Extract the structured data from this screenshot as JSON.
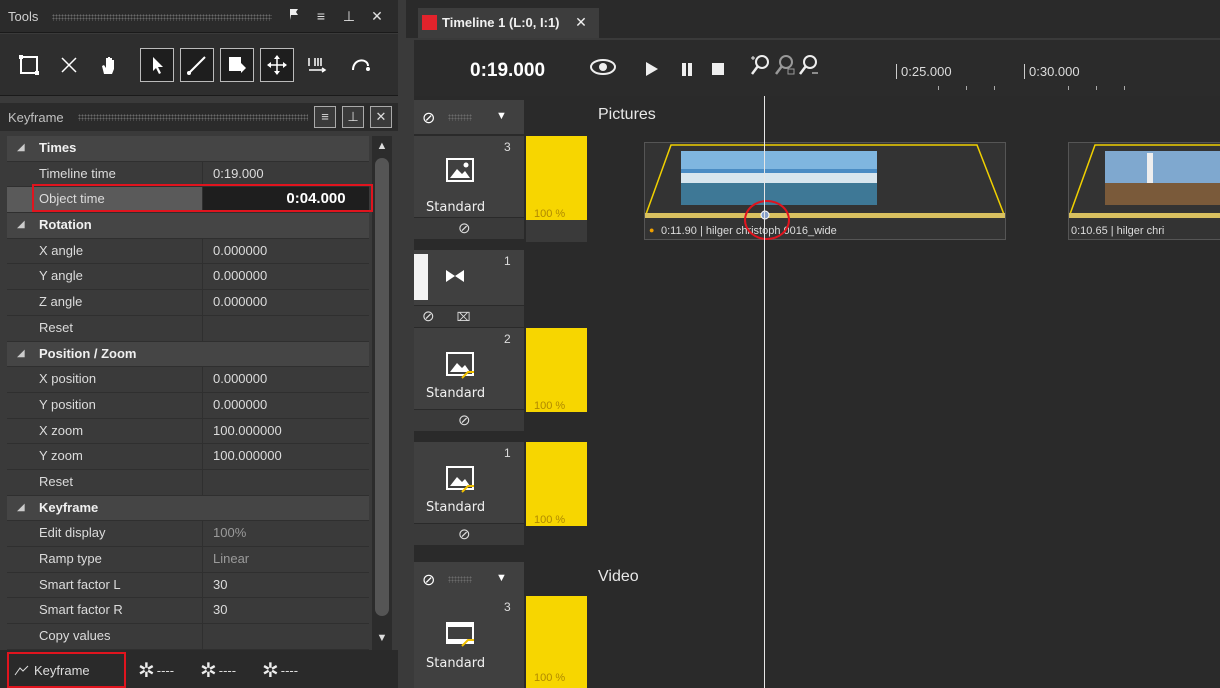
{
  "tools_panel": {
    "title": "Tools",
    "header_buttons": [
      "flag-icon",
      "menu-icon",
      "pin-icon",
      "close-icon"
    ],
    "tools": [
      "select-rect-icon",
      "cut-icon",
      "hand-icon",
      "pointer-icon",
      "line-icon",
      "shape-icon",
      "move-icon",
      "split-icon",
      "curve-icon"
    ]
  },
  "keyframe_panel": {
    "title": "Keyframe",
    "header_buttons": [
      "menu-icon",
      "pin-icon",
      "close-icon"
    ],
    "rows": [
      {
        "type": "category",
        "name": "Times"
      },
      {
        "type": "prop",
        "name": "Timeline time",
        "value": "0:19.000"
      },
      {
        "type": "prop",
        "name": "Object time",
        "value": "0:04.000",
        "selected": true
      },
      {
        "type": "category",
        "name": "Rotation"
      },
      {
        "type": "prop",
        "name": "X angle",
        "value": "0.000000"
      },
      {
        "type": "prop",
        "name": "Y angle",
        "value": "0.000000"
      },
      {
        "type": "prop",
        "name": "Z angle",
        "value": "0.000000"
      },
      {
        "type": "prop",
        "name": "Reset",
        "value": ""
      },
      {
        "type": "category",
        "name": "Position / Zoom"
      },
      {
        "type": "prop",
        "name": "X position",
        "value": "0.000000"
      },
      {
        "type": "prop",
        "name": "Y position",
        "value": "0.000000"
      },
      {
        "type": "prop",
        "name": "X zoom",
        "value": "100.000000"
      },
      {
        "type": "prop",
        "name": "Y zoom",
        "value": "100.000000"
      },
      {
        "type": "prop",
        "name": "Reset",
        "value": ""
      },
      {
        "type": "category",
        "name": "Keyframe"
      },
      {
        "type": "prop",
        "name": "Edit display",
        "value": "100%",
        "dim": true
      },
      {
        "type": "prop",
        "name": "Ramp type",
        "value": "Linear",
        "dim": true
      },
      {
        "type": "prop",
        "name": "Smart factor L",
        "value": "30"
      },
      {
        "type": "prop",
        "name": "Smart factor R",
        "value": "30"
      },
      {
        "type": "prop",
        "name": "Copy values",
        "value": ""
      }
    ]
  },
  "bottom_tabs": {
    "keyframe": "Keyframe",
    "tab2": "----",
    "tab3": "----",
    "tab4": "----"
  },
  "timeline": {
    "tab_title": "Timeline 1 (L:0, I:1)",
    "current_time": "0:19.000",
    "ruler": [
      "0:25.000",
      "0:30.000"
    ],
    "groups": {
      "pictures": "Pictures",
      "video": "Video"
    },
    "tracks": [
      {
        "num": "3",
        "label": "Standard",
        "opacity": "100 %"
      },
      {
        "num": "1",
        "label": "",
        "opacity": ""
      },
      {
        "num": "2",
        "label": "Standard",
        "opacity": "100 %"
      },
      {
        "num": "1",
        "label": "Standard",
        "opacity": "100 %"
      },
      {
        "num": "3",
        "label": "Standard",
        "opacity": "100 %"
      }
    ],
    "clips": [
      {
        "label": "0:11.90 | hilger christoph 0016_wide"
      },
      {
        "label": "0:10.65 | hilger chri"
      }
    ]
  }
}
